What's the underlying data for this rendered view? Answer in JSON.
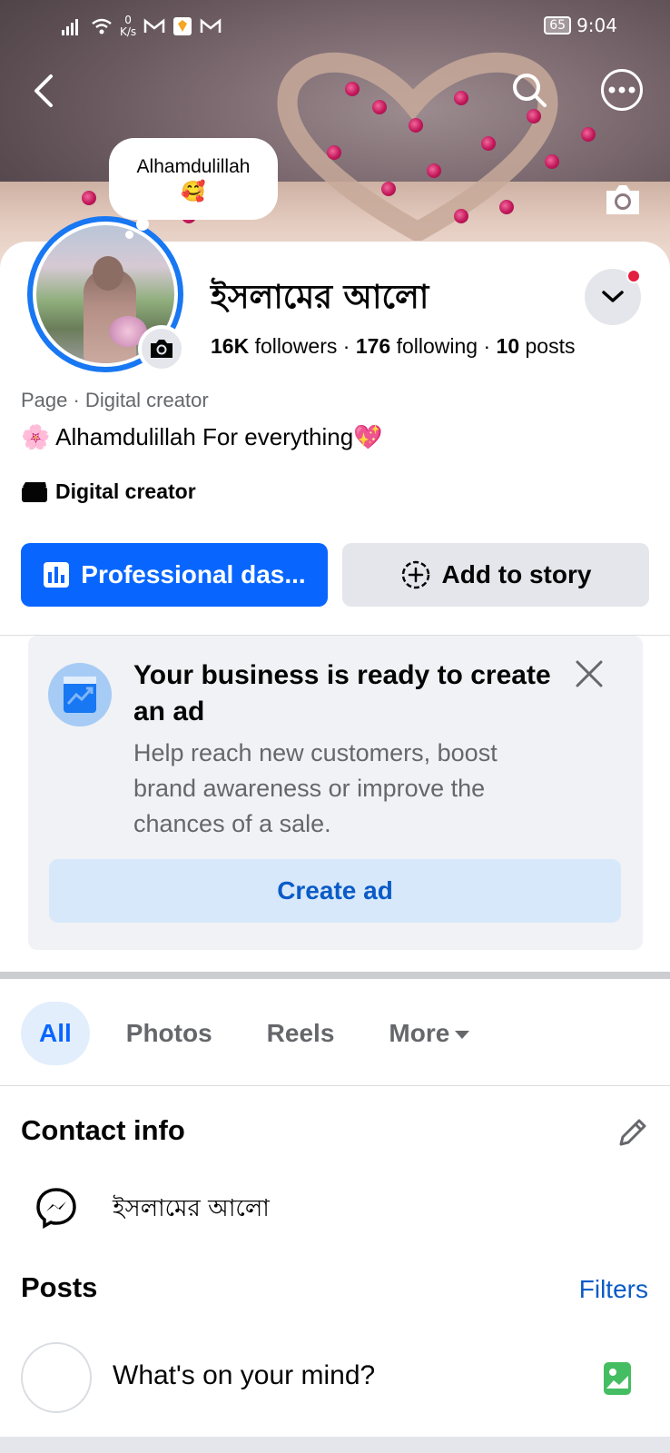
{
  "status_bar": {
    "net_speed_value": "0",
    "net_speed_unit": "K/s",
    "battery": "65",
    "time": "9:04"
  },
  "profile": {
    "note": "Alhamdulillah",
    "note_emoji": "🥰",
    "name": "ইসলামের আলো",
    "followers_count": "16K",
    "followers_label": "followers",
    "following_count": "176",
    "following_label": "following",
    "posts_count": "10",
    "posts_label": "posts",
    "separator": "·",
    "category": "Page · Digital creator",
    "bio": "🌸 Alhamdulillah For everything💖",
    "creator_label": "Digital creator"
  },
  "actions": {
    "professional_label": "Professional das...",
    "story_label": "Add to story"
  },
  "ad_card": {
    "title": "Your business is ready to create an ad",
    "description": "Help reach new customers, boost brand awareness or improve the chances of a sale.",
    "button_label": "Create ad"
  },
  "tabs": {
    "all": "All",
    "photos": "Photos",
    "reels": "Reels",
    "more": "More"
  },
  "contact": {
    "title": "Contact info",
    "messenger_name": "ইসলামের আলো"
  },
  "posts": {
    "title": "Posts",
    "filters_label": "Filters",
    "composer_placeholder": "What's on your mind?"
  },
  "colors": {
    "primary": "#0866ff",
    "secondary_button": "#e4e6eb",
    "link": "#0a5bc7",
    "notification_dot": "#e41e3f",
    "photo_icon": "#45bd62"
  },
  "icons": {
    "back": "back-arrow-icon",
    "search": "search-icon",
    "more": "more-options-icon",
    "cover_camera": "camera-icon",
    "avatar_camera": "camera-icon",
    "dropdown": "chevron-down-icon",
    "creator": "clapperboard-icon",
    "dashboard": "dashboard-icon",
    "story": "add-story-icon",
    "ad": "trend-chart-icon",
    "close": "close-icon",
    "edit": "pencil-icon",
    "messenger": "messenger-icon",
    "photo": "photo-icon"
  }
}
